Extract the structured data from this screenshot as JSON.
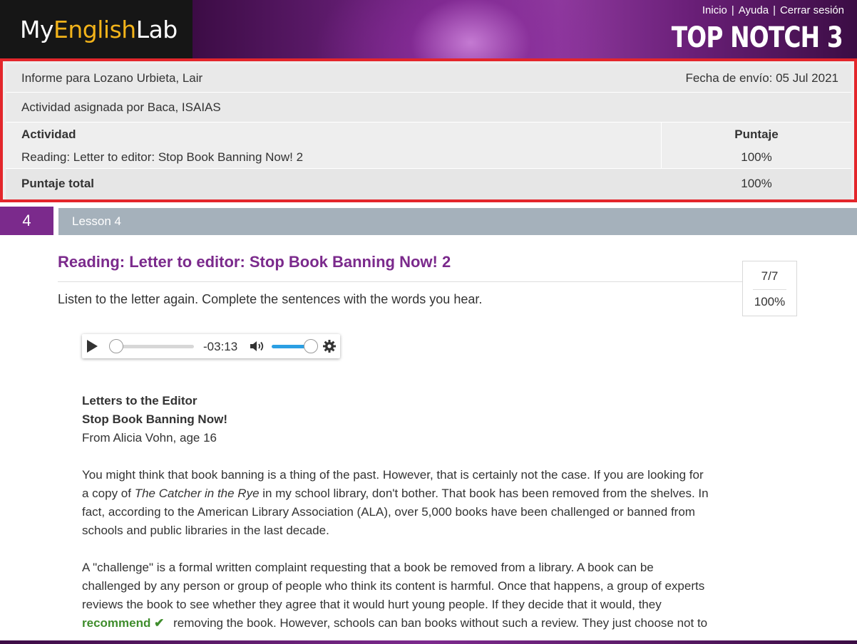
{
  "header": {
    "logo": {
      "part1": "My",
      "part2": "English",
      "part3": "Lab"
    },
    "links": [
      "Inicio",
      "Ayuda",
      "Cerrar sesión"
    ],
    "separator": "|",
    "brand": "TOP NOTCH 3"
  },
  "report": {
    "student": "Informe para Lozano Urbieta, Lair",
    "submitted": "Fecha de envío: 05 Jul 2021",
    "assigned_by": "Actividad asignada por Baca, ISAIAS",
    "columns": {
      "activity": "Actividad",
      "score": "Puntaje"
    },
    "row": {
      "activity": "Reading: Letter to editor: Stop Book Banning Now! 2",
      "score": "100%"
    },
    "total": {
      "label": "Puntaje total",
      "score": "100%"
    }
  },
  "lesson": {
    "number": "4",
    "label": "Lesson 4"
  },
  "activity": {
    "title": "Reading: Letter to editor: Stop Book Banning Now! 2",
    "score_fraction": "7/7",
    "score_percent": "100%",
    "instructions": "Listen to the letter again. Complete the sentences with the words you hear."
  },
  "player": {
    "time": "-03:13",
    "progress": 0,
    "volume": 0.9
  },
  "letter": {
    "heading1": "Letters to the Editor",
    "heading2": "Stop Book Banning Now!",
    "byline": "From Alicia Vohn, age 16",
    "p1_a": "You might think that book banning is a thing of the past. However, that is certainly not the case. If you are looking for",
    "p1_b1": "a copy of ",
    "p1_b_italic": "The Catcher in the Rye",
    "p1_b2": " in my school library, don't bother. That book has been removed from the shelves. In",
    "p1_c": "fact, according to the American Library Association (ALA), over 5,000 books have been challenged or banned from",
    "p1_d": "schools and public libraries in the last decade.",
    "p2_a": "A \"challenge\" is a formal written complaint requesting that a book be removed from a library. A book can be",
    "p2_b": "challenged by any person or group of people who think its content is harmful. Once that happens, a group of experts",
    "p2_c": "reviews the book to see whether they agree that it would hurt young people. If they decide that it would, they",
    "p2_answer": "recommend",
    "p2_check": "✔",
    "p2_d": " removing the book. However, schools can ban books without such a review. They just choose not to"
  },
  "colors": {
    "accent_purple": "#7b2a8c",
    "highlight_red": "#e3262b",
    "answer_green": "#3f8d2c",
    "lesson_bar": "#a5b1bb"
  }
}
